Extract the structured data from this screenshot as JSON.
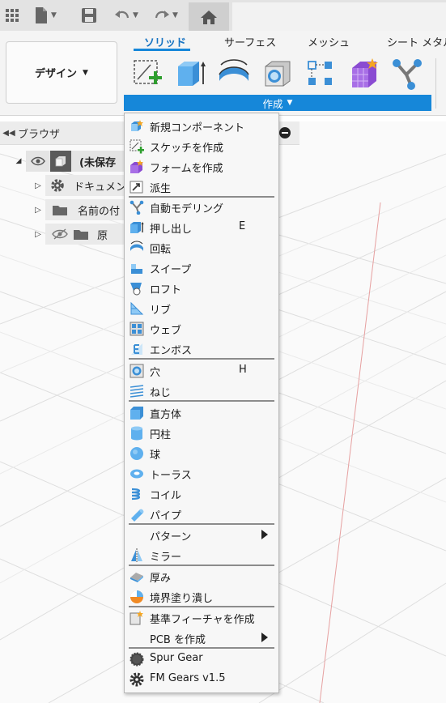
{
  "quick_toolbar": {
    "icons": [
      "grid-icon",
      "file-icon",
      "save-icon",
      "undo-icon",
      "redo-icon",
      "home-icon"
    ]
  },
  "workspace": {
    "label": "デザイン"
  },
  "ribbon": {
    "tabs": [
      "ソリッド",
      "サーフェス",
      "メッシュ",
      "シート メタル"
    ],
    "active_tab": "ソリッド",
    "tools": [
      "new-sketch-icon",
      "extrude-icon",
      "revolve-icon",
      "hole-icon",
      "pattern-icon",
      "form-icon",
      "automodel-icon"
    ],
    "group_label": "作成"
  },
  "browser": {
    "title": "ブラウザ",
    "root_label": "(未保存",
    "items": [
      {
        "label": "ドキュメン"
      },
      {
        "label": "名前の付"
      },
      {
        "label": "原"
      }
    ]
  },
  "menu": {
    "items": [
      {
        "label": "新規コンポーネント",
        "icon": "new-component-icon",
        "shortcut": ""
      },
      {
        "label": "スケッチを作成",
        "icon": "create-sketch-icon",
        "shortcut": ""
      },
      {
        "label": "フォームを作成",
        "icon": "create-form-icon",
        "shortcut": ""
      },
      {
        "label": "派生",
        "icon": "derive-icon",
        "shortcut": ""
      },
      {
        "label": "自動モデリング",
        "icon": "automodel-icon",
        "shortcut": ""
      },
      {
        "label": "押し出し",
        "icon": "extrude-icon",
        "shortcut": "E"
      },
      {
        "label": "回転",
        "icon": "revolve-icon",
        "shortcut": ""
      },
      {
        "label": "スイープ",
        "icon": "sweep-icon",
        "shortcut": ""
      },
      {
        "label": "ロフト",
        "icon": "loft-icon",
        "shortcut": ""
      },
      {
        "label": "リブ",
        "icon": "rib-icon",
        "shortcut": ""
      },
      {
        "label": "ウェブ",
        "icon": "web-icon",
        "shortcut": ""
      },
      {
        "label": "エンボス",
        "icon": "emboss-icon",
        "shortcut": ""
      },
      {
        "label": "穴",
        "icon": "hole-icon",
        "shortcut": "H"
      },
      {
        "label": "ねじ",
        "icon": "thread-icon",
        "shortcut": ""
      },
      {
        "label": "直方体",
        "icon": "box-icon",
        "shortcut": ""
      },
      {
        "label": "円柱",
        "icon": "cylinder-icon",
        "shortcut": ""
      },
      {
        "label": "球",
        "icon": "sphere-icon",
        "shortcut": ""
      },
      {
        "label": "トーラス",
        "icon": "torus-icon",
        "shortcut": ""
      },
      {
        "label": "コイル",
        "icon": "coil-icon",
        "shortcut": ""
      },
      {
        "label": "パイプ",
        "icon": "pipe-icon",
        "shortcut": ""
      },
      {
        "label": "パターン",
        "icon": "",
        "shortcut": "",
        "submenu": true
      },
      {
        "label": "ミラー",
        "icon": "mirror-icon",
        "shortcut": ""
      },
      {
        "label": "厚み",
        "icon": "thicken-icon",
        "shortcut": ""
      },
      {
        "label": "境界塗り潰し",
        "icon": "boundary-fill-icon",
        "shortcut": ""
      },
      {
        "label": "基準フィーチャを作成",
        "icon": "base-feature-icon",
        "shortcut": ""
      },
      {
        "label": "PCB を作成",
        "icon": "",
        "shortcut": "",
        "submenu": true
      },
      {
        "label": "Spur Gear",
        "icon": "spur-gear-icon",
        "shortcut": ""
      },
      {
        "label": "FM Gears v1.5",
        "icon": "fm-gears-icon",
        "shortcut": ""
      }
    ]
  }
}
